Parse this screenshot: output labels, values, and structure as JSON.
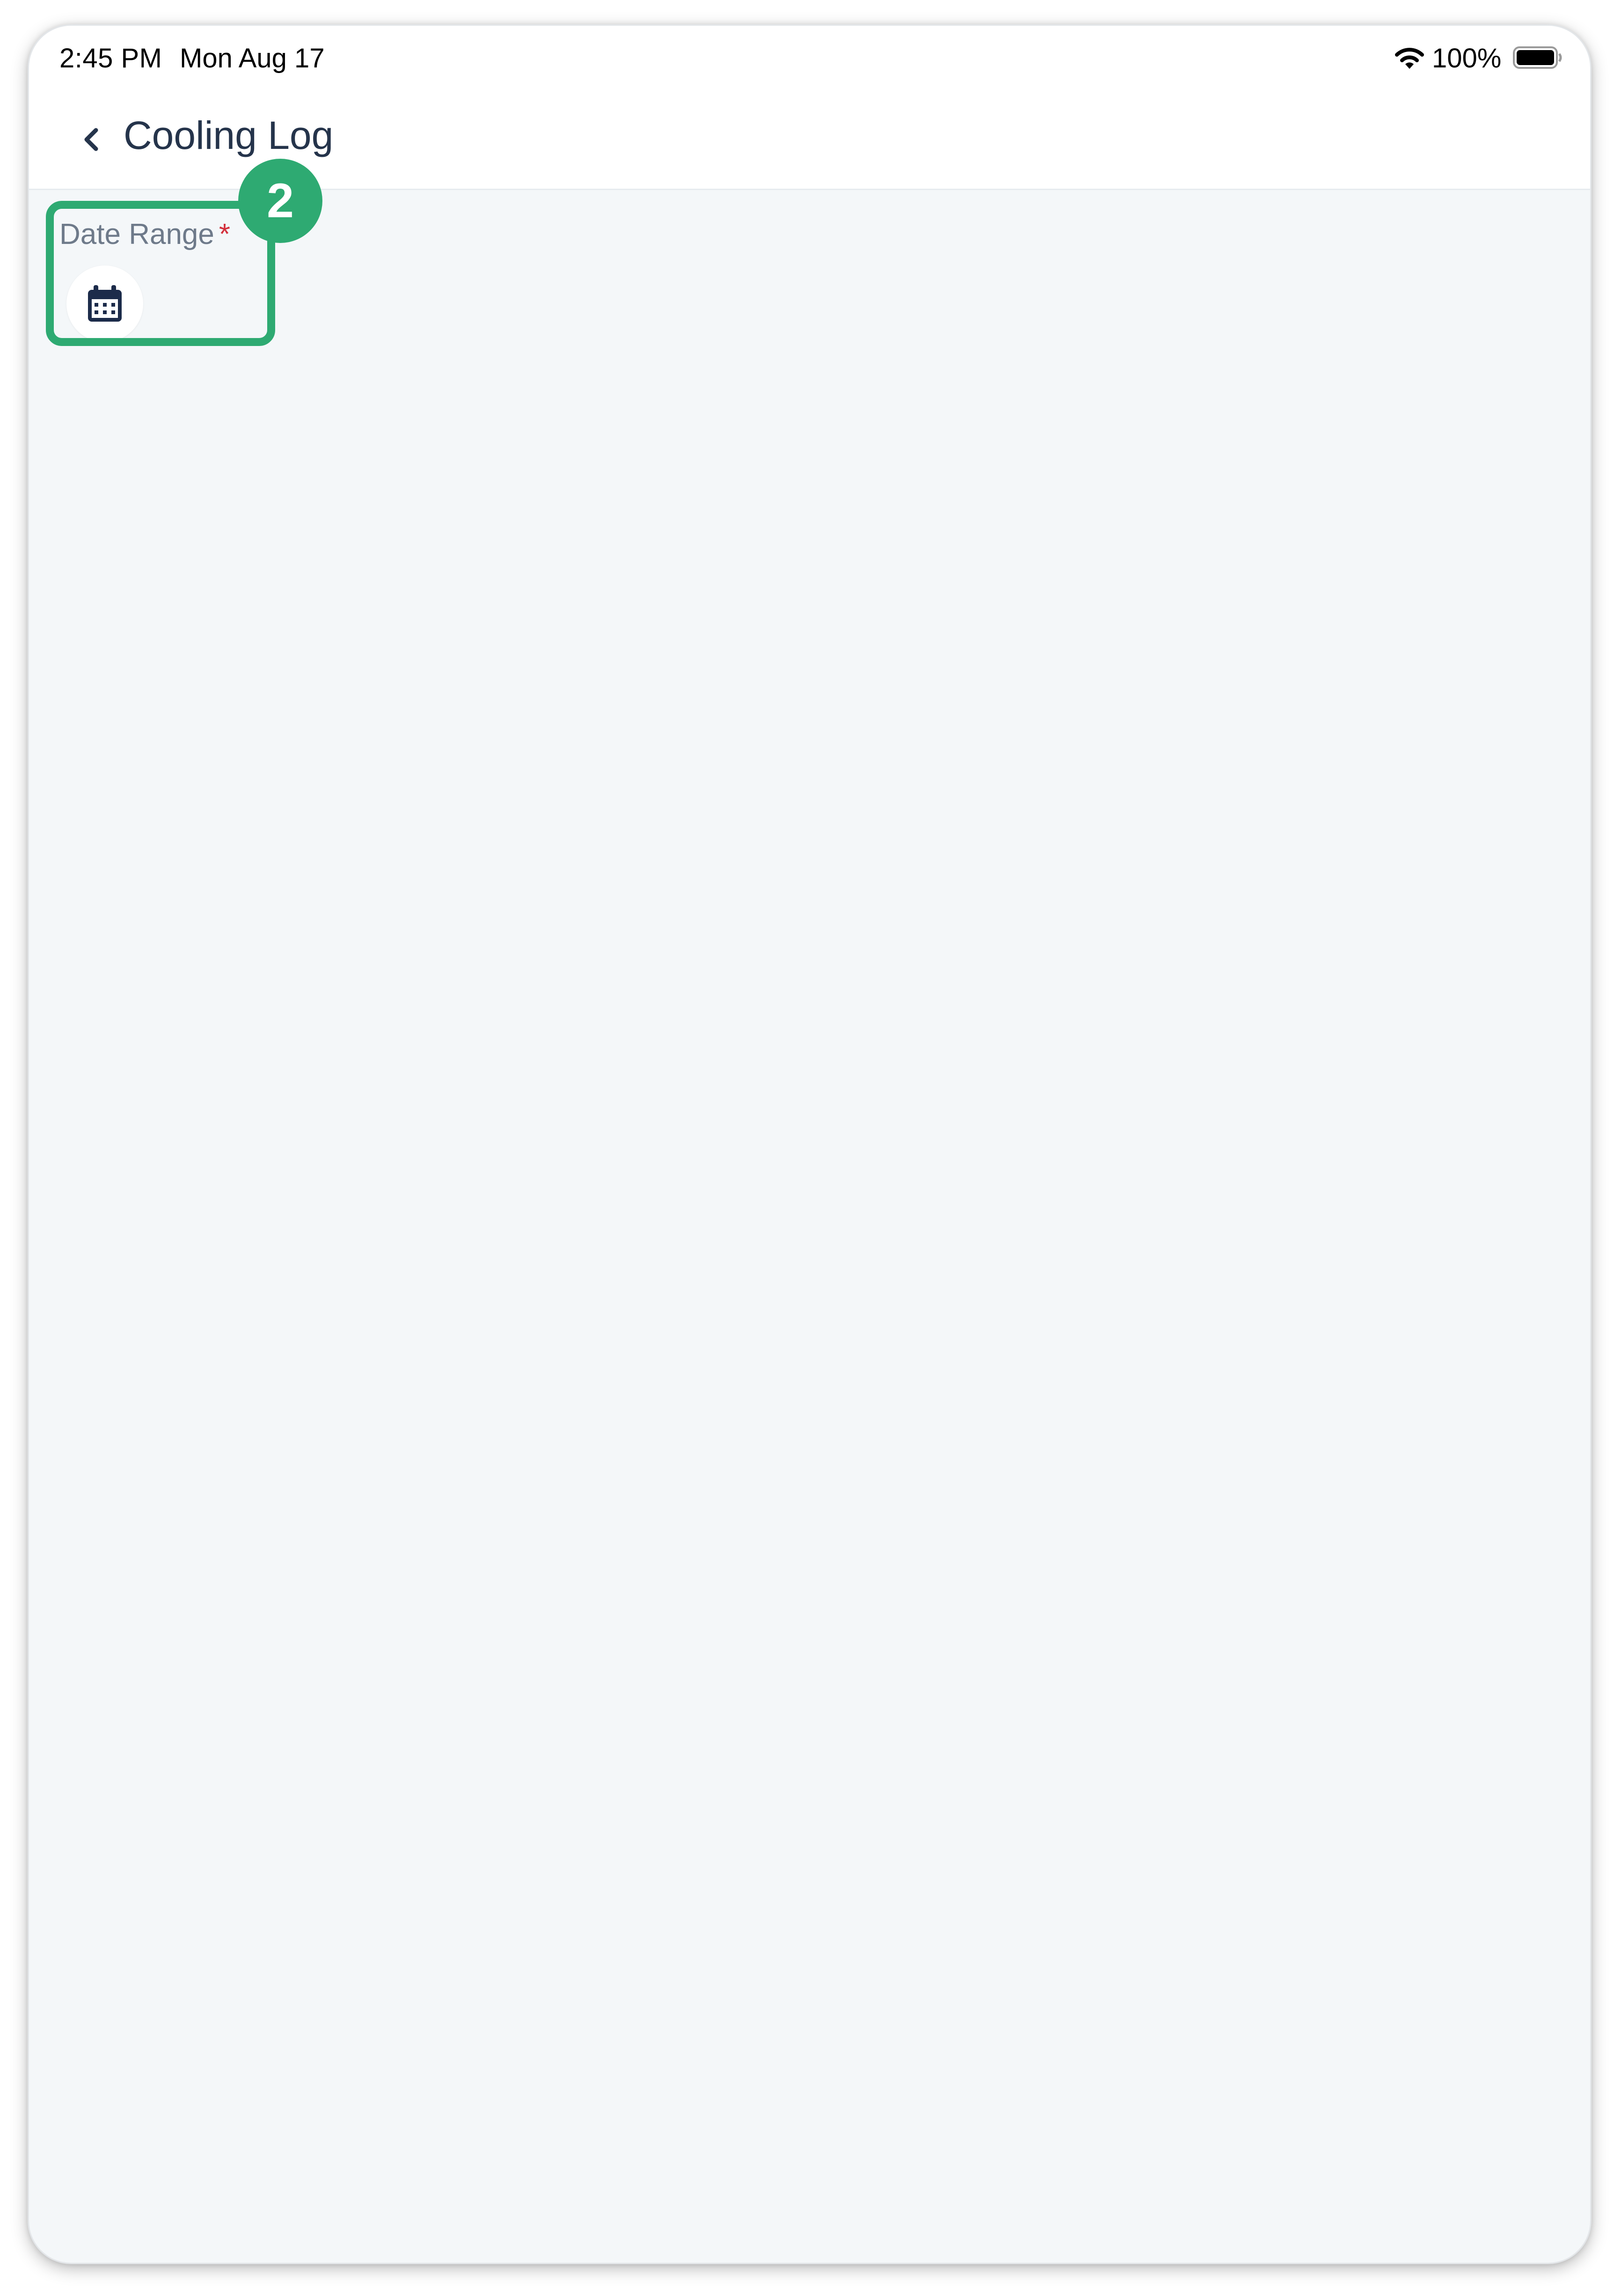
{
  "status_bar": {
    "time": "2:45 PM",
    "date": "Mon Aug 17",
    "battery_percent": "100%",
    "icons": [
      "wifi-icon",
      "battery-icon"
    ]
  },
  "header": {
    "back_icon": "chevron-left-icon",
    "title": "Cooling Log"
  },
  "form": {
    "date_range": {
      "label": "Date Range",
      "required_mark": "*",
      "icon": "calendar-icon"
    }
  },
  "annotation": {
    "step_number": "2"
  },
  "colors": {
    "accent_green": "#2eaa72",
    "title_text": "#25344b",
    "label_text": "#6e7a8a",
    "required_red": "#d32f3b",
    "content_background": "#f4f7f9",
    "icon_navy": "#1c2b4a"
  }
}
